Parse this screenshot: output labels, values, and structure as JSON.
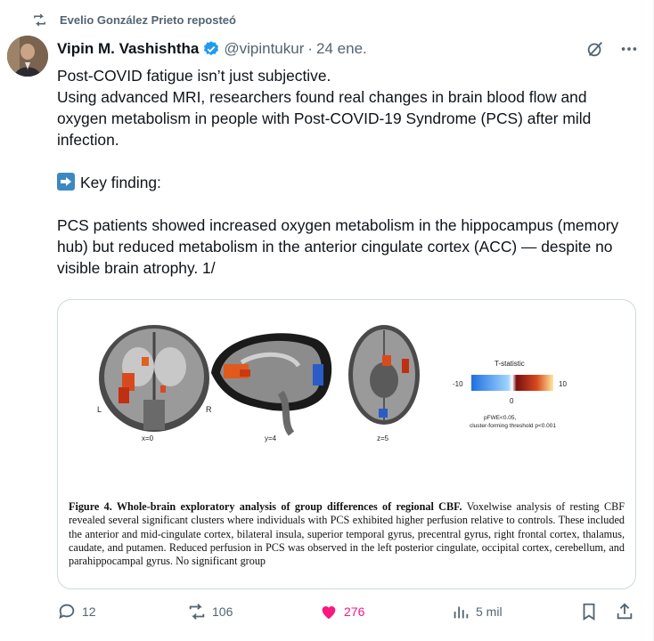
{
  "repost": {
    "icon": "repost-icon",
    "label": "Evelio González Prieto reposteó"
  },
  "author": {
    "name": "Vipin M. Vashishtha",
    "handle": "@vipintukur",
    "separator": "·",
    "date": "24 ene."
  },
  "tweet": {
    "line1": "Post-COVID fatigue isn’t just subjective.",
    "line2": "Using advanced MRI, researchers found real changes in brain blood flow and oxygen metabolism in people with Post-COVID-19 Syndrome (PCS) after mild infection.",
    "key_finding": "Key finding:",
    "line3": "PCS patients showed increased oxygen metabolism in the hippocampus (memory hub) but reduced metabolism in the anterior cingulate cortex (ACC) — despite no visible brain atrophy.  1/"
  },
  "figure": {
    "coord_x": "x=0",
    "coord_y": "y=4",
    "coord_z": "z=5",
    "left_label": "L",
    "right_label": "R",
    "colorbar_title": "T-statistic",
    "colorbar_min": "-10",
    "colorbar_max": "10",
    "colorbar_zero": "0",
    "threshold_line1": "pFWE<0.05,",
    "threshold_line2": "cluster-forming threshold p<0.001",
    "caption_title": "Figure 4. Whole-brain exploratory analysis of group differences of regional CBF.",
    "caption_body": " Voxelwise analysis of resting CBF revealed several significant clusters where individuals with PCS exhibited higher perfusion relative to controls. These included the anterior and mid-cingulate cortex, bilateral insula, superior temporal gyrus, precentral gyrus, right frontal cortex, thalamus, caudate, and putamen. Reduced perfusion in PCS was observed in the left posterior cingulate, occipital cortex, cerebellum, and parahippocampal gyrus. No significant group"
  },
  "actions": {
    "replies": "12",
    "reposts": "106",
    "likes": "276",
    "views": "5 mil"
  },
  "colors": {
    "like": "#f91880",
    "muted": "#536471",
    "verified": "#1d9bf0"
  }
}
